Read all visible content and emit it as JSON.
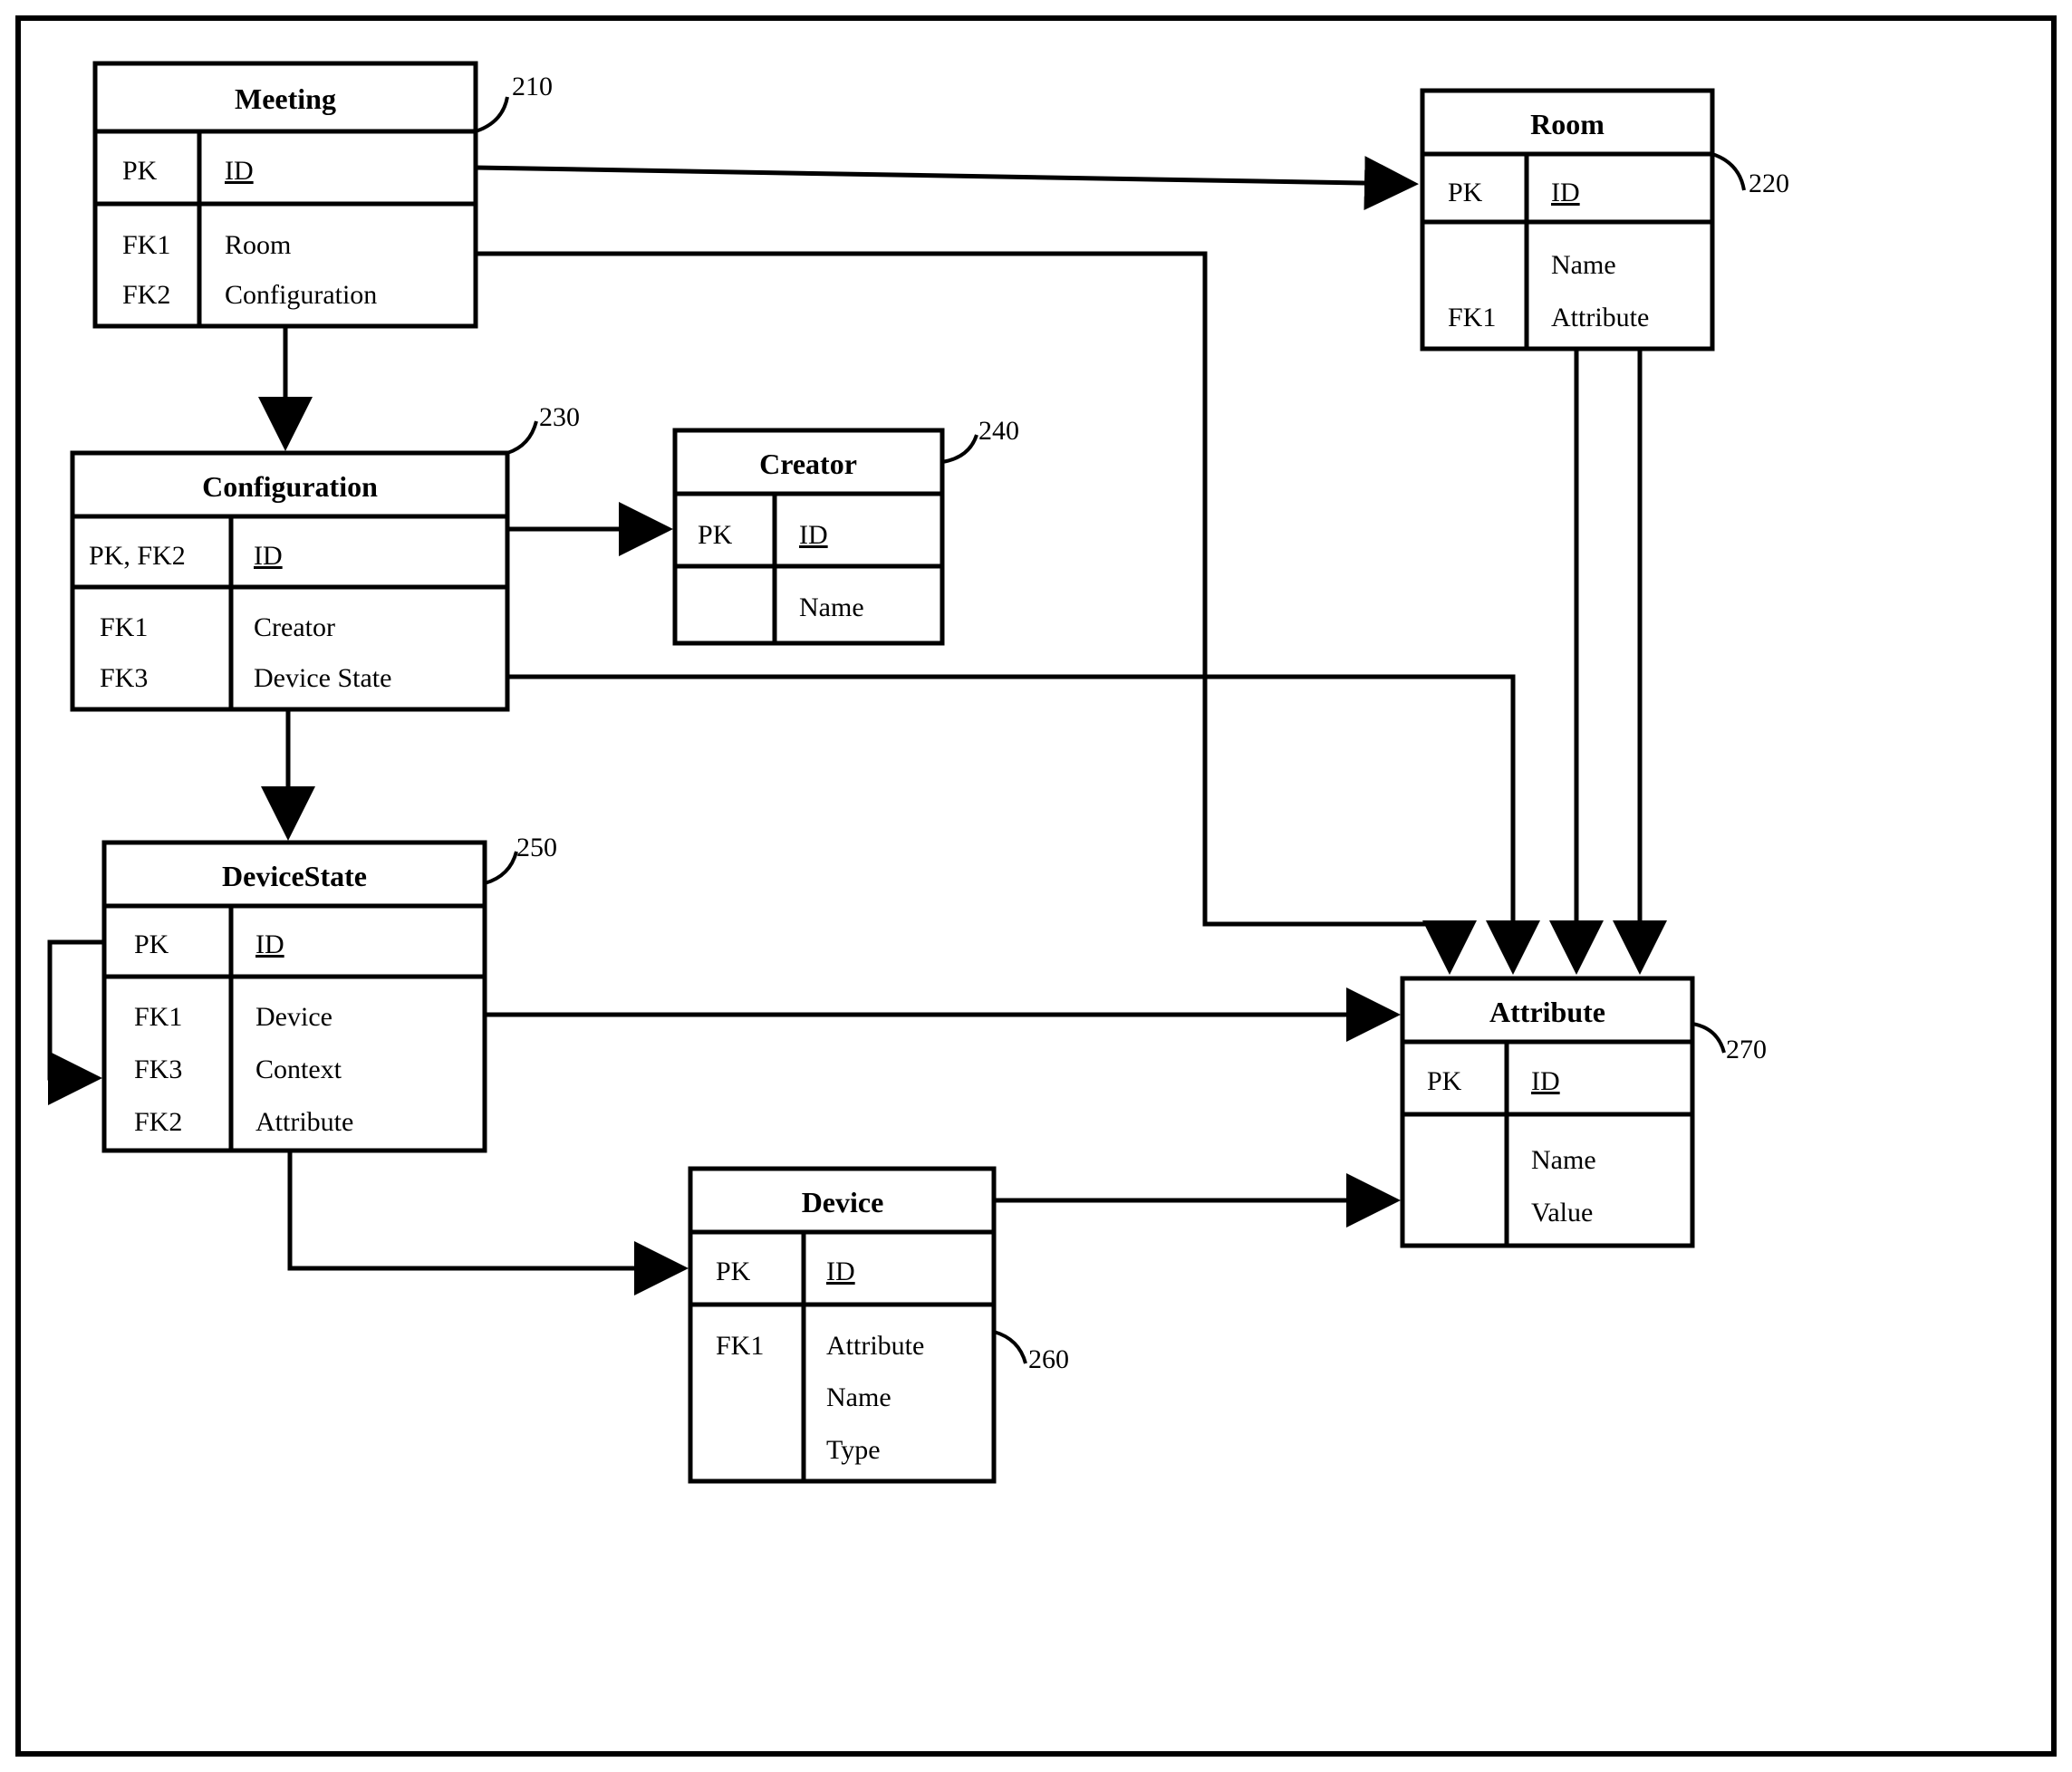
{
  "entities": {
    "meeting": {
      "title": "Meeting",
      "label": "210",
      "pk": "PK",
      "pkField": "ID",
      "rows": [
        {
          "key": "FK1",
          "field": "Room"
        },
        {
          "key": "FK2",
          "field": "Configuration"
        }
      ]
    },
    "room": {
      "title": "Room",
      "label": "220",
      "pk": "PK",
      "pkField": "ID",
      "rows": [
        {
          "key": "",
          "field": "Name"
        },
        {
          "key": "FK1",
          "field": "Attribute"
        }
      ]
    },
    "configuration": {
      "title": "Configuration",
      "label": "230",
      "pk": "PK, FK2",
      "pkField": "ID",
      "rows": [
        {
          "key": "FK1",
          "field": "Creator"
        },
        {
          "key": "FK3",
          "field": "Device State"
        }
      ]
    },
    "creator": {
      "title": "Creator",
      "label": "240",
      "pk": "PK",
      "pkField": "ID",
      "rows": [
        {
          "key": "",
          "field": "Name"
        }
      ]
    },
    "devicestate": {
      "title": "DeviceState",
      "label": "250",
      "pk": "PK",
      "pkField": "ID",
      "rows": [
        {
          "key": "FK1",
          "field": "Device"
        },
        {
          "key": "FK3",
          "field": "Context"
        },
        {
          "key": "FK2",
          "field": "Attribute"
        }
      ]
    },
    "device": {
      "title": "Device",
      "label": "260",
      "pk": "PK",
      "pkField": "ID",
      "rows": [
        {
          "key": "FK1",
          "field": "Attribute"
        },
        {
          "key": "",
          "field": "Name"
        },
        {
          "key": "",
          "field": "Type"
        }
      ]
    },
    "attribute": {
      "title": "Attribute",
      "label": "270",
      "pk": "PK",
      "pkField": "ID",
      "rows": [
        {
          "key": "",
          "field": "Name"
        },
        {
          "key": "",
          "field": "Value"
        }
      ]
    }
  }
}
